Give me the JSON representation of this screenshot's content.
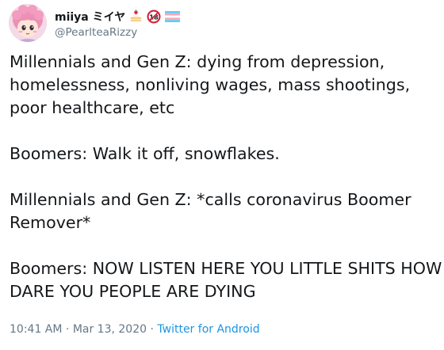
{
  "tweet": {
    "author": {
      "display_name": "miiya ミイヤ",
      "handle": "@PearlteaRizzy",
      "name_icons": [
        "shortcake-icon",
        "eighteen-plus-icon",
        "trans-flag-icon"
      ],
      "avatar_icon": "anime-avatar-icon"
    },
    "paragraphs": [
      "Millennials and Gen Z: dying from depression, homelessness, nonliving wages, mass shootings, poor healthcare, etc",
      "Boomers: Walk it off, snowflakes.",
      "Millennials and Gen Z: *calls coronavirus Boomer Remover*",
      "Boomers: NOW LISTEN HERE YOU LITTLE SHITS HOW DARE YOU PEOPLE ARE DYING"
    ],
    "meta": {
      "time": "10:41 AM",
      "separator": "·",
      "date": "Mar 13, 2020",
      "source": "Twitter for Android"
    }
  },
  "colors": {
    "text": "#14171a",
    "secondary": "#657786",
    "link": "#1b95e0"
  }
}
